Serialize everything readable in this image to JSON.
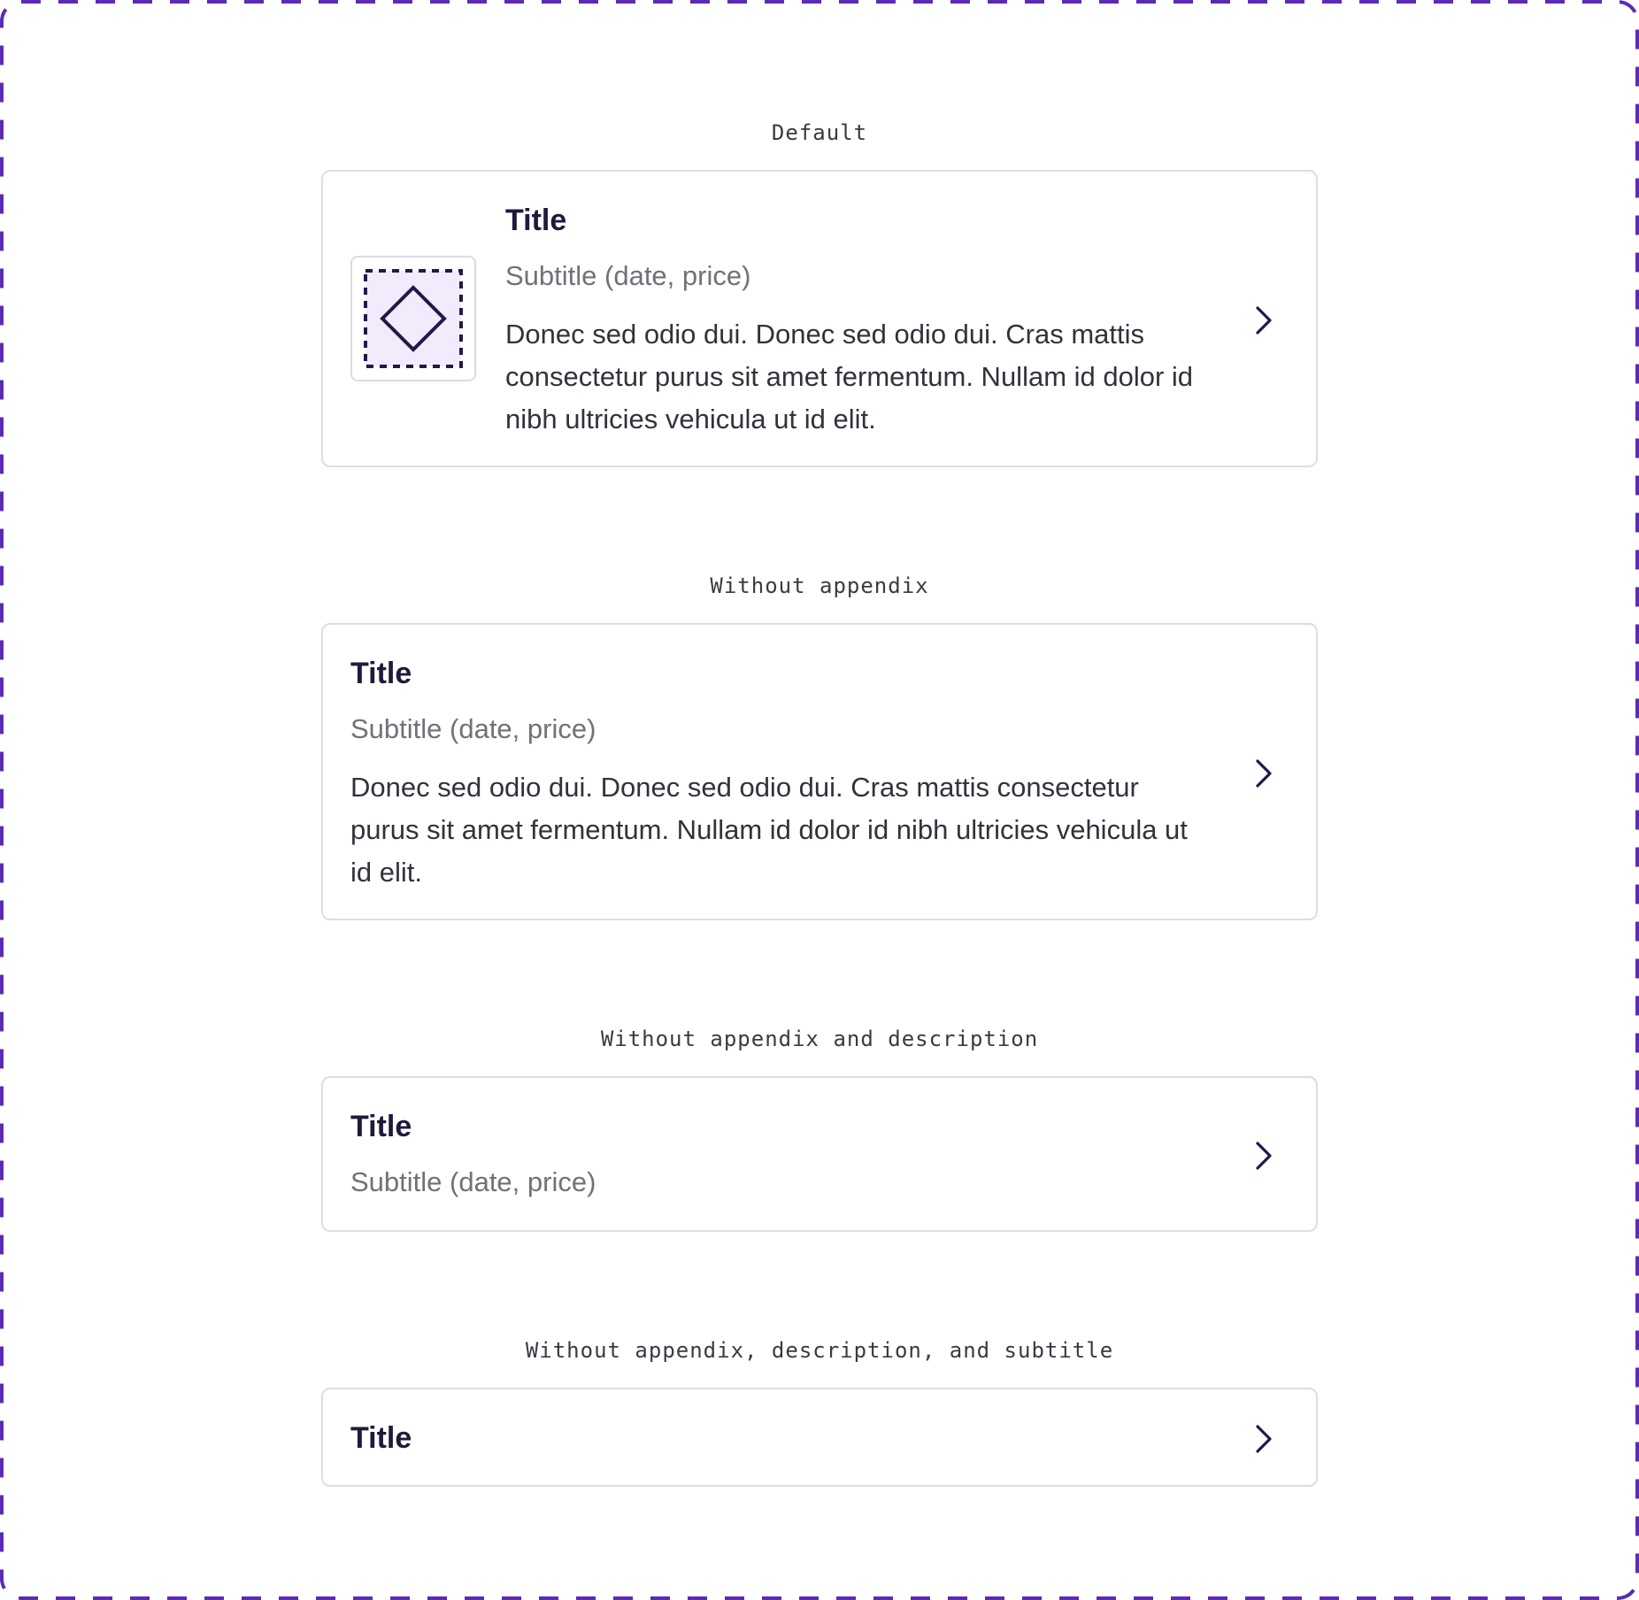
{
  "colors": {
    "frame_border": "#5b2bb5",
    "icon_stroke": "#1f1a4a",
    "icon_fill": "#f1ebfc",
    "card_border": "#dedde2",
    "title": "#1f1a3a",
    "subtitle": "#727078"
  },
  "sections": [
    {
      "label": "Default",
      "card": {
        "title": "Title",
        "subtitle": "Subtitle (date, price)",
        "description": "Donec sed odio dui. Donec sed odio dui. Cras mattis consectetur purus sit amet fermentum. Nullam id dolor id nibh ultricies vehicula ut id elit.",
        "appendix_icon": "placeholder-diamond-icon",
        "action_icon": "chevron-right-icon"
      }
    },
    {
      "label": "Without appendix",
      "card": {
        "title": "Title",
        "subtitle": "Subtitle (date, price)",
        "description": "Donec sed odio dui. Donec sed odio dui. Cras mattis consectetur purus sit amet fermentum. Nullam id dolor id nibh ultricies vehicula ut id elit.",
        "action_icon": "chevron-right-icon"
      }
    },
    {
      "label": "Without appendix and description",
      "card": {
        "title": "Title",
        "subtitle": "Subtitle (date, price)",
        "action_icon": "chevron-right-icon"
      }
    },
    {
      "label": "Without appendix, description, and subtitle",
      "card": {
        "title": "Title",
        "action_icon": "chevron-right-icon"
      }
    }
  ]
}
